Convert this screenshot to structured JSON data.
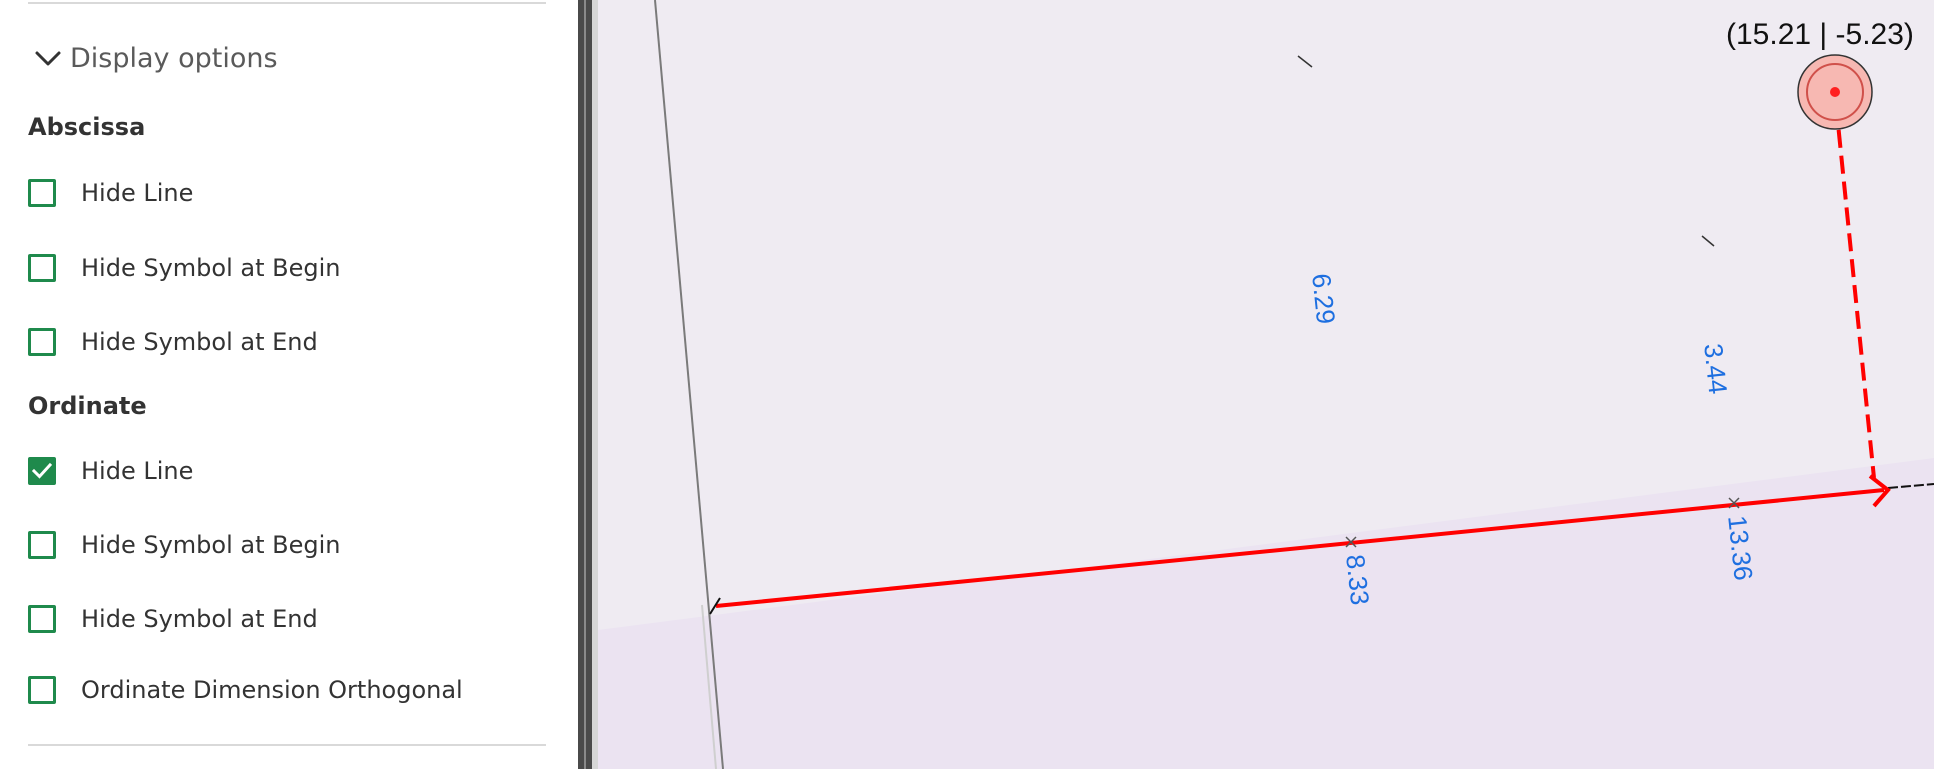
{
  "display_options": {
    "title": "Display options",
    "expanded": true,
    "abscissa": {
      "label": "Abscissa",
      "options": [
        {
          "label": "Hide Line",
          "checked": false
        },
        {
          "label": "Hide Symbol at Begin",
          "checked": false
        },
        {
          "label": "Hide Symbol at End",
          "checked": false
        }
      ]
    },
    "ordinate": {
      "label": "Ordinate",
      "options": [
        {
          "label": "Hide Line",
          "checked": true
        },
        {
          "label": "Hide Symbol at Begin",
          "checked": false
        },
        {
          "label": "Hide Symbol at End",
          "checked": false
        },
        {
          "label": "Ordinate Dimension Orthogonal",
          "checked": false
        }
      ]
    }
  },
  "canvas": {
    "cursor_coordinate": "(15.21 | -5.23)",
    "dimension_labels": [
      "6.29",
      "3.44",
      "8.33",
      "13.36"
    ],
    "colors": {
      "background": "#efebf2",
      "dimension_line": "#ff0000",
      "dimension_text": "#1e6fe0",
      "checkbox_accent": "#1f8a4c"
    }
  }
}
